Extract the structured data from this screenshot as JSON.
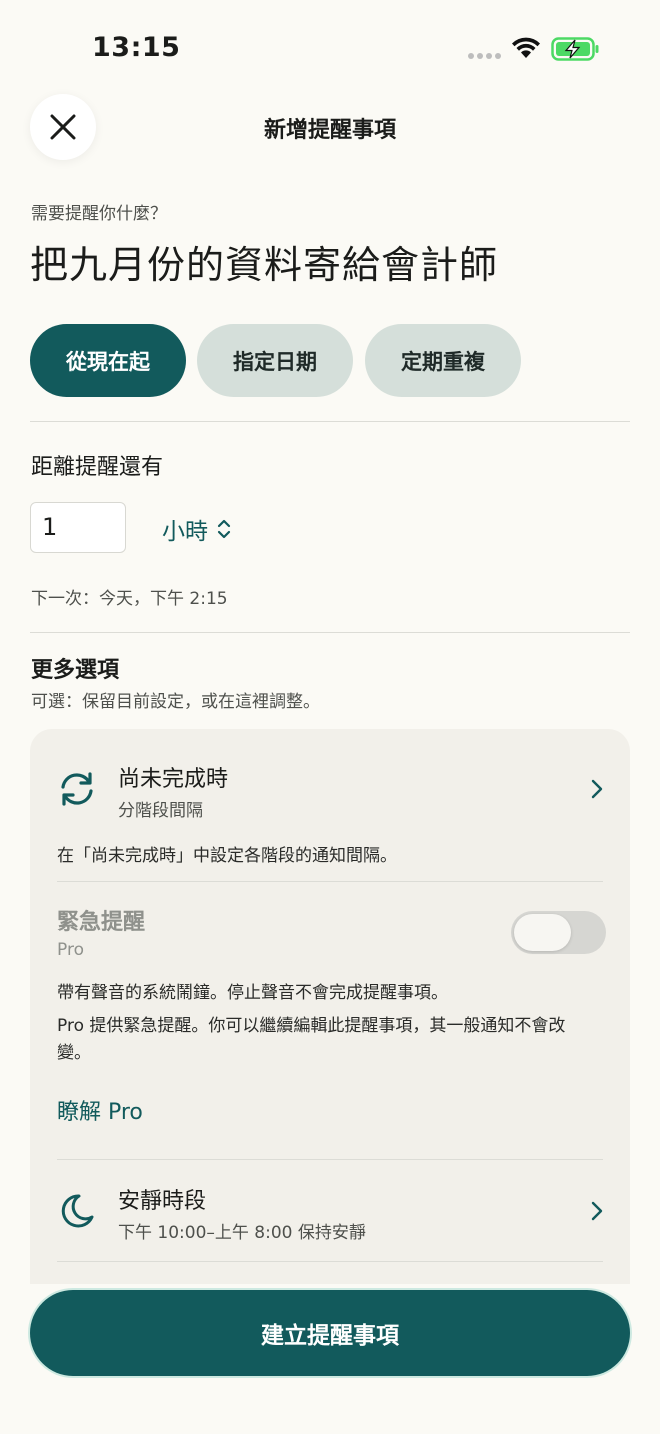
{
  "status_bar": {
    "time": "13:15"
  },
  "header": {
    "title": "新增提醒事項"
  },
  "question": {
    "label": "需要提醒你什麼？",
    "value": "把九月份的資料寄給會計師"
  },
  "segments": {
    "from_now": "從現在起",
    "specific_date": "指定日期",
    "repeat": "定期重複"
  },
  "countdown": {
    "label": "距離提醒還有",
    "amount": "1",
    "unit": "小時",
    "next": "下一次：今天，下午 2:15"
  },
  "more": {
    "title": "更多選項",
    "subtitle": "可選：保留目前設定，或在這裡調整。",
    "until_done": {
      "title": "尚未完成時",
      "subtitle": "分階段間隔",
      "description": "在「尚未完成時」中設定各階段的通知間隔。"
    },
    "urgent": {
      "title": "緊急提醒",
      "badge": "Pro",
      "enabled": false,
      "description": "帶有聲音的系統鬧鐘。停止聲音不會完成提醒事項。",
      "pro_note": "Pro 提供緊急提醒。你可以繼續編輯此提醒事項，其一般通知不會改變。",
      "learn_link": "瞭解 Pro"
    },
    "quiet_hours": {
      "title": "安靜時段",
      "subtitle": "下午 10:00–上午 8:00 保持安靜"
    }
  },
  "create_button": "建立提醒事項",
  "colors": {
    "accent": "#125a5c",
    "segment_inactive": "#d5dfda",
    "card": "#f2f0ea",
    "battery_charge": "#4cd964"
  }
}
